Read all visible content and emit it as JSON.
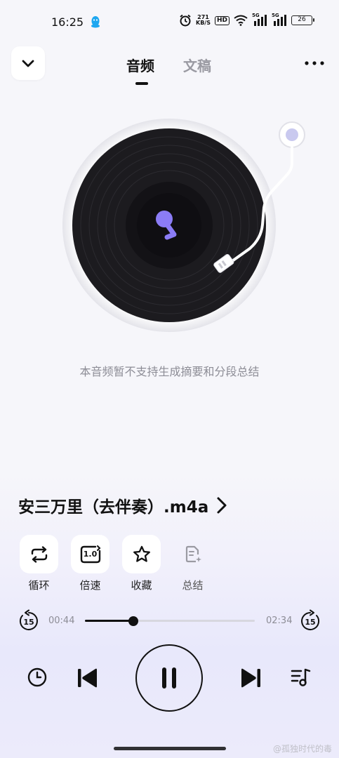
{
  "status_bar": {
    "time": "16:25",
    "net_speed_value": "271",
    "net_speed_unit": "KB/S",
    "hd_label": "HD",
    "sim1_label": "5G",
    "sim2_label": "5G",
    "battery": "26"
  },
  "header": {
    "tabs": [
      {
        "label": "音频",
        "active": true
      },
      {
        "label": "文稿",
        "active": false
      }
    ]
  },
  "player": {
    "notice": "本音频暂不支持生成摘要和分段总结",
    "song_title": "安三万里（去伴奏）.m4a",
    "actions": [
      {
        "label": "循环",
        "icon": "loop-icon",
        "enabled": true
      },
      {
        "label": "倍速",
        "icon": "speed-icon",
        "enabled": true,
        "badge": "1.0"
      },
      {
        "label": "收藏",
        "icon": "star-icon",
        "enabled": true
      },
      {
        "label": "总结",
        "icon": "summary-icon",
        "enabled": false
      }
    ],
    "elapsed": "00:44",
    "duration": "02:34",
    "progress": 0.285,
    "skip_back_seconds": "15",
    "skip_forward_seconds": "15"
  },
  "watermark": "@孤独时代的毒",
  "colors": {
    "accent_purple": "#8b7cf6",
    "disc": "#1c1b1f",
    "background": "#f6f6fa"
  }
}
